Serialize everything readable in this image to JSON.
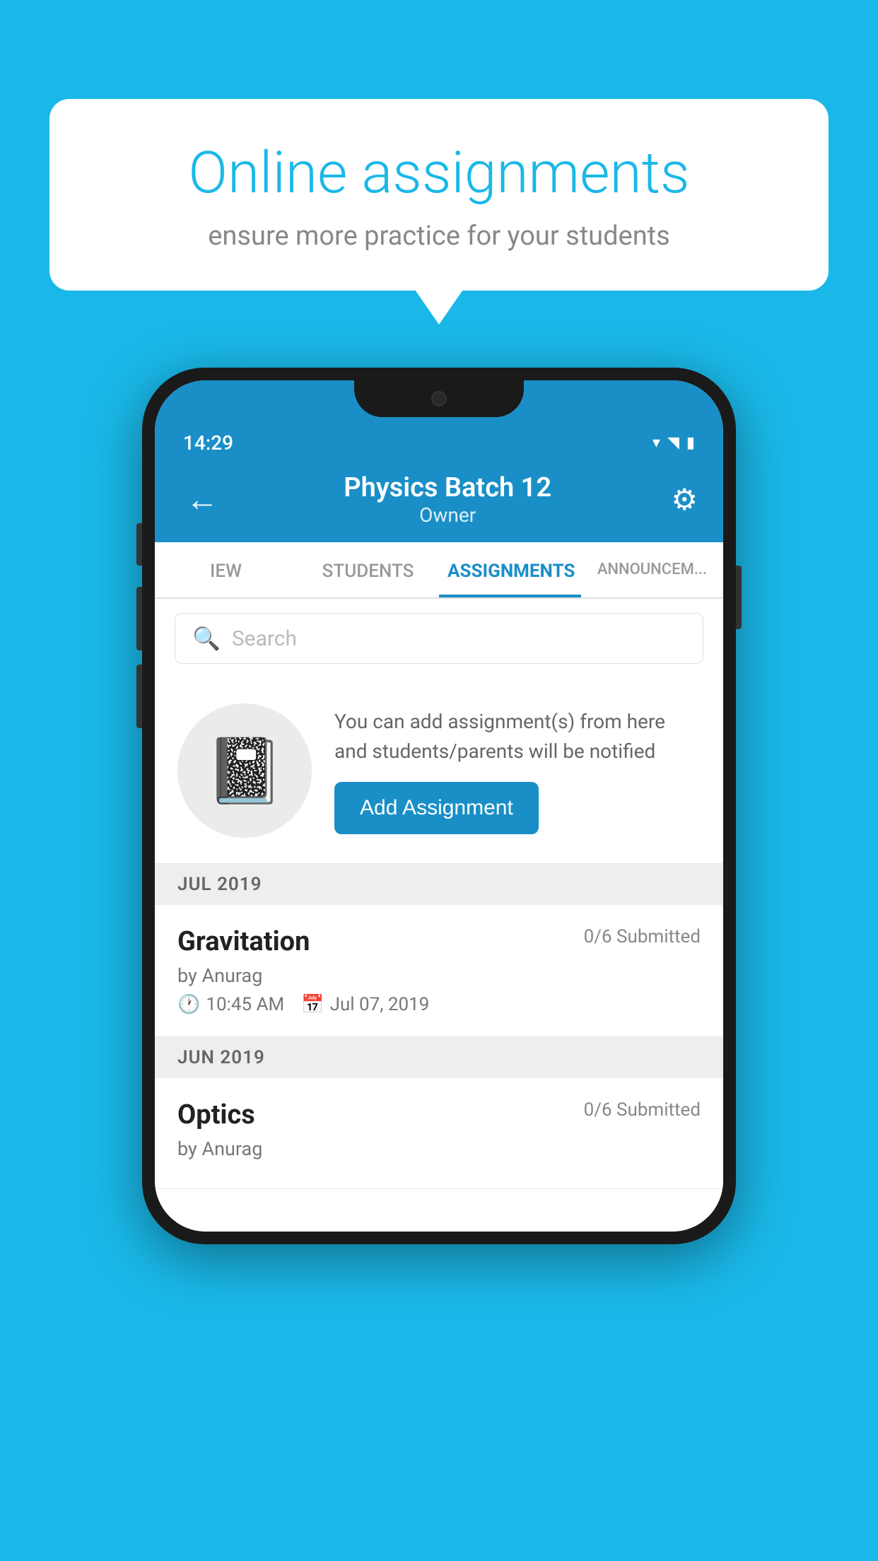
{
  "background_color": "#1ab8e8",
  "speech_bubble": {
    "title": "Online assignments",
    "subtitle": "ensure more practice for your students"
  },
  "phone": {
    "status_bar": {
      "time": "14:29",
      "icons": [
        "wifi",
        "signal",
        "battery"
      ]
    },
    "header": {
      "title": "Physics Batch 12",
      "subtitle": "Owner",
      "back_label": "←",
      "settings_label": "⚙"
    },
    "tabs": [
      {
        "label": "IEW",
        "active": false
      },
      {
        "label": "STUDENTS",
        "active": false
      },
      {
        "label": "ASSIGNMENTS",
        "active": true
      },
      {
        "label": "ANNOUNCEM...",
        "active": false
      }
    ],
    "search": {
      "placeholder": "Search"
    },
    "add_assignment_section": {
      "description": "You can add assignment(s) from here and students/parents will be notified",
      "button_label": "Add Assignment"
    },
    "sections": [
      {
        "month": "JUL 2019",
        "assignments": [
          {
            "name": "Gravitation",
            "submitted": "0/6 Submitted",
            "by": "by Anurag",
            "time": "10:45 AM",
            "date": "Jul 07, 2019"
          }
        ]
      },
      {
        "month": "JUN 2019",
        "assignments": [
          {
            "name": "Optics",
            "submitted": "0/6 Submitted",
            "by": "by Anurag",
            "time": "",
            "date": ""
          }
        ]
      }
    ]
  }
}
